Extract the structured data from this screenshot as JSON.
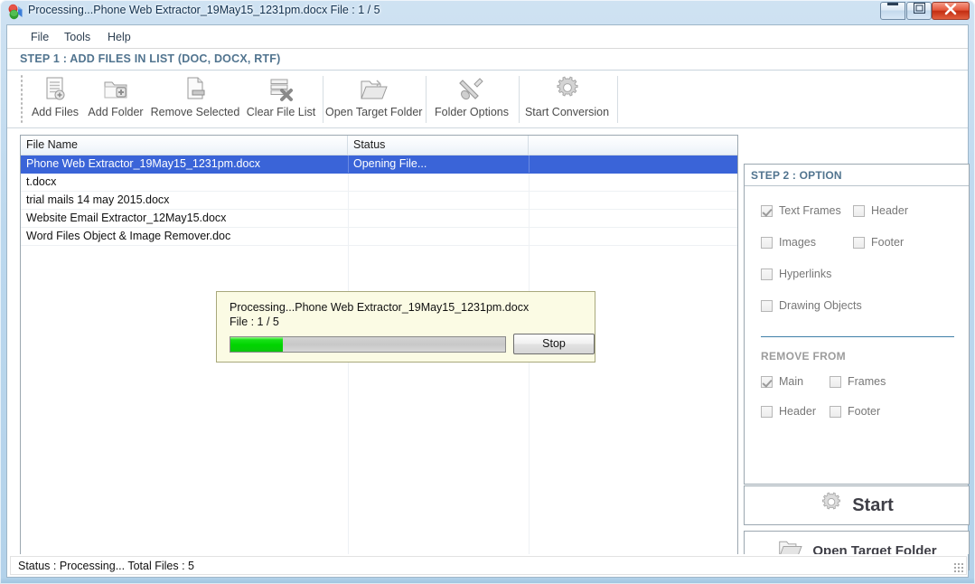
{
  "window": {
    "title": "Processing...Phone Web Extractor_19May15_1231pm.docx File : 1 / 5",
    "app_icon": "app-icon",
    "buttons": {
      "minimize": "minimize",
      "maximize": "maximize",
      "close": "close"
    },
    "frame_color": "#b3d2ea"
  },
  "menubar": {
    "items": [
      {
        "label": "File"
      },
      {
        "label": "Tools"
      },
      {
        "label": "Help"
      }
    ]
  },
  "step1": {
    "label": "STEP 1 : ADD FILES IN LIST (DOC, DOCX, RTF)",
    "color": "#51748f"
  },
  "toolbar": {
    "items": [
      {
        "label": "Add Files",
        "icon": "add-files-icon",
        "enabled": false
      },
      {
        "label": "Add Folder",
        "icon": "add-folder-icon",
        "enabled": false
      },
      {
        "label": "Remove Selected",
        "icon": "remove-selected-icon",
        "enabled": false
      },
      {
        "label": "Clear File List",
        "icon": "clear-file-list-icon",
        "enabled": false
      },
      {
        "label": "Open Target Folder",
        "icon": "open-folder-icon",
        "enabled": false
      },
      {
        "label": "Folder Options",
        "icon": "tools-icon",
        "enabled": false
      },
      {
        "label": "Start Conversion",
        "icon": "gear-icon",
        "enabled": false
      }
    ]
  },
  "filelist": {
    "columns": [
      "File Name",
      "Status",
      ""
    ],
    "rows": [
      {
        "name": "Phone Web Extractor_19May15_1231pm.docx",
        "status": "Opening File...",
        "selected": true
      },
      {
        "name": "t.docx",
        "status": "",
        "selected": false
      },
      {
        "name": "trial mails 14 may 2015.docx",
        "status": "",
        "selected": false
      },
      {
        "name": "Website Email Extractor_12May15.docx",
        "status": "",
        "selected": false
      },
      {
        "name": "Word Files Object & Image Remover.doc",
        "status": "",
        "selected": false
      }
    ],
    "selection_color": "#3a64d8"
  },
  "progress_dialog": {
    "line1": "Processing...Phone Web Extractor_19May15_1231pm.docx",
    "line2": "File : 1 / 5",
    "percent": 19,
    "bar_color": "#00d400",
    "stop_label": "Stop"
  },
  "options": {
    "header": "STEP 2 : OPTION",
    "checkboxes": [
      {
        "label": "Text Frames",
        "checked": true,
        "enabled": false
      },
      {
        "label": "Header",
        "checked": false,
        "enabled": false
      },
      {
        "label": "Images",
        "checked": false,
        "enabled": false
      },
      {
        "label": "Footer",
        "checked": false,
        "enabled": false
      },
      {
        "label": "Hyperlinks",
        "checked": false,
        "enabled": false
      },
      {
        "label": "Drawing Objects",
        "checked": false,
        "enabled": false
      }
    ],
    "remove_from_label": "REMOVE FROM",
    "remove_from": [
      {
        "label": "Main",
        "checked": true,
        "enabled": false
      },
      {
        "label": "Frames",
        "checked": false,
        "enabled": false
      },
      {
        "label": "Header",
        "checked": false,
        "enabled": false
      },
      {
        "label": "Footer",
        "checked": false,
        "enabled": false
      }
    ],
    "divider_color": "#3f7fa8"
  },
  "actions": {
    "start_label": "Start",
    "start_icon": "gear-icon",
    "open_target_label": "Open Target Folder",
    "open_target_icon": "open-folder-icon"
  },
  "statusbar": {
    "text": "Status  :  Processing...  Total Files : 5"
  }
}
